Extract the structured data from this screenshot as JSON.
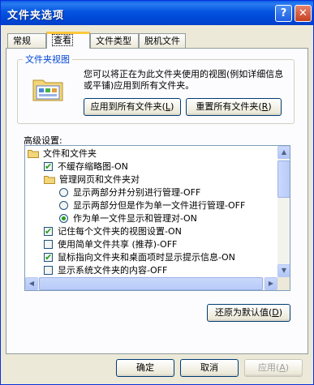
{
  "window": {
    "title": "文件夹选项",
    "help_label": "?",
    "close_label": "✕"
  },
  "tabs": [
    {
      "label": "常规"
    },
    {
      "label": "查看"
    },
    {
      "label": "文件类型"
    },
    {
      "label": "脱机文件"
    }
  ],
  "folder_views": {
    "group_label": "文件夹视图",
    "description": "您可以将正在为此文件夹使用的视图(例如详细信息或平铺)应用到所有文件夹。",
    "apply_all_label": "应用到所有文件夹",
    "apply_all_key": "L",
    "reset_all_label": "重置所有文件夹",
    "reset_all_key": "R"
  },
  "advanced": {
    "label": "高级设置:",
    "items": [
      {
        "type": "folder",
        "label": "文件和文件夹"
      },
      {
        "type": "checkbox",
        "checked": true,
        "label": "不缓存缩略图-ON"
      },
      {
        "type": "folder",
        "label": "管理网页和文件夹对"
      },
      {
        "type": "radio",
        "selected": false,
        "label": "显示两部分并分别进行管理-OFF"
      },
      {
        "type": "radio",
        "selected": false,
        "label": "显示两部分但是作为单一文件进行管理-OFF"
      },
      {
        "type": "radio",
        "selected": true,
        "label": "作为单一文件显示和管理对-ON"
      },
      {
        "type": "checkbox",
        "checked": true,
        "label": "记住每个文件夹的视图设置-ON"
      },
      {
        "type": "checkbox",
        "checked": false,
        "label": "使用简单文件共享 (推荐)-OFF"
      },
      {
        "type": "checkbox",
        "checked": true,
        "label": "鼠标指向文件夹和桌面项时显示提示信息-ON"
      },
      {
        "type": "checkbox",
        "checked": false,
        "label": "显示系统文件夹的内容-OFF"
      }
    ],
    "restore_label": "还原为默认值",
    "restore_key": "D"
  },
  "footer": {
    "ok_label": "确定",
    "cancel_label": "取消",
    "apply_label": "应用",
    "apply_key": "A"
  },
  "colors": {
    "titlebar": "#0054e3",
    "dialog_bg": "#ece9d8",
    "check_green": "#21a121"
  }
}
